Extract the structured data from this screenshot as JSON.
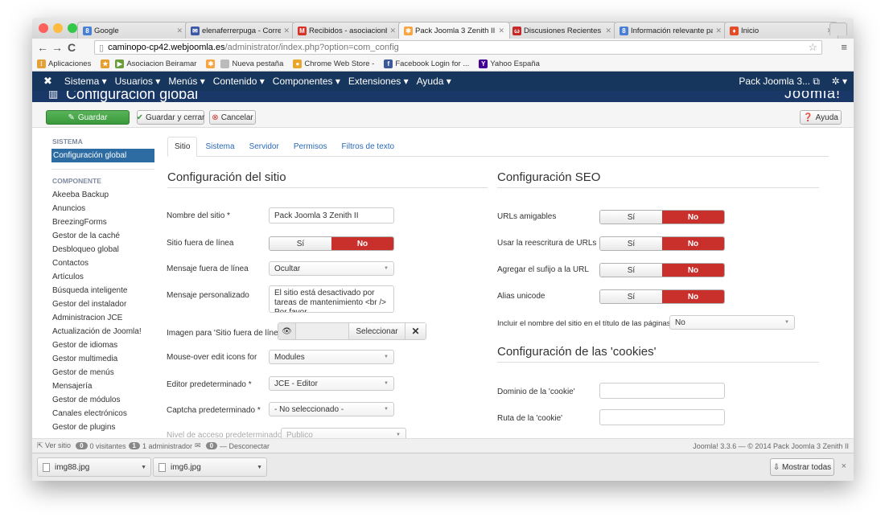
{
  "browser": {
    "tabs": [
      {
        "title": "Google",
        "favicon": "google-icon",
        "color": "#4a7fd6",
        "glyph": "8"
      },
      {
        "title": "elenaferrerpuga - Correo",
        "favicon": "mail-icon",
        "color": "#3b57a8",
        "glyph": "✉"
      },
      {
        "title": "Recibidos - asociacionbe",
        "favicon": "gmail-icon",
        "color": "#d93025",
        "glyph": "M"
      },
      {
        "title": "Pack Joomla 3 Zenith II -",
        "favicon": "joomla-icon",
        "color": "#f9a541",
        "glyph": "✱"
      },
      {
        "title": "Discusiones Recientes (1:",
        "favicon": "discussion-icon",
        "color": "#c62828",
        "glyph": "ω"
      },
      {
        "title": "Información relevante par",
        "favicon": "google-icon",
        "color": "#4a7fd6",
        "glyph": "8"
      },
      {
        "title": "Inicio",
        "favicon": "flame-icon",
        "color": "#e34c26",
        "glyph": "♦"
      }
    ],
    "url_host": "caminopo-cp42.webjoomla.es",
    "url_path": "/administrator/index.php?option=com_config",
    "bookmarks": [
      {
        "label": "Aplicaciones",
        "icon": "apps-icon",
        "color": "#e4a13a",
        "glyph": "⁞"
      },
      {
        "label": "",
        "icon": "bookmark-icon",
        "color": "#e59d2b",
        "glyph": "★"
      },
      {
        "label": "Asociacion Beiramar",
        "icon": "bookmark-icon",
        "color": "#6a9d3a",
        "glyph": "▶"
      },
      {
        "label": "",
        "icon": "joomla-icon",
        "color": "#f9a541",
        "glyph": "✱"
      },
      {
        "label": "Nueva pestaña",
        "icon": "page-icon",
        "color": "#bbbbbb",
        "glyph": ""
      },
      {
        "label": "Chrome Web Store -",
        "icon": "chrome-icon",
        "color": "#e8a72a",
        "glyph": "●"
      },
      {
        "label": "Facebook Login for ...",
        "icon": "facebook-icon",
        "color": "#3b5998",
        "glyph": "f"
      },
      {
        "label": "Yahoo España",
        "icon": "yahoo-icon",
        "color": "#410093",
        "glyph": "Y"
      }
    ]
  },
  "joomla": {
    "menu": [
      "Sistema ▾",
      "Usuarios ▾",
      "Menús ▾",
      "Contenido ▾",
      "Componentes ▾",
      "Extensiones ▾",
      "Ayuda ▾"
    ],
    "site_link": "Pack Joomla 3... ⧉",
    "settings_menu": "✲ ▾",
    "page_title": "Configuración global",
    "logo_text": "Joomla!",
    "buttons": {
      "save": "Guardar",
      "save_close": "Guardar y cerrar",
      "cancel": "Cancelar",
      "help": "Ayuda"
    }
  },
  "sidebar": {
    "system_heading": "SISTEMA",
    "system_items": [
      "Configuración global"
    ],
    "component_heading": "COMPONENTE",
    "component_items": [
      "Akeeba Backup",
      "Anuncios",
      "BreezingForms",
      "Gestor de la caché",
      "Desbloqueo global",
      "Contactos",
      "Artículos",
      "Búsqueda inteligente",
      "Gestor del instalador",
      "Administracion JCE",
      "Actualización de Joomla!",
      "Gestor de idiomas",
      "Gestor multimedia",
      "Gestor de menús",
      "Mensajería",
      "Gestor de módulos",
      "Canales electrónicos",
      "Gestor de plugins"
    ]
  },
  "tabs": [
    "Sitio",
    "Sistema",
    "Servidor",
    "Permisos",
    "Filtros de texto"
  ],
  "site": {
    "heading": "Configuración del sitio",
    "site_name_label": "Nombre del sitio *",
    "site_name_value": "Pack Joomla 3 Zenith II",
    "offline_label": "Sitio fuera de línea",
    "offline_message_label": "Mensaje fuera de línea",
    "offline_message_value": "Ocultar",
    "custom_message_label": "Mensaje personalizado",
    "custom_message_value": "El sitio está desactivado por tareas de mantenimiento <br /> Por favor,",
    "offline_image_label": "Imagen para 'Sitio fuera de línea'",
    "select_button": "Seleccionar",
    "mouseover_label": "Mouse-over edit icons for",
    "mouseover_value": "Modules",
    "editor_label": "Editor predeterminado *",
    "editor_value": "JCE - Editor",
    "captcha_label": "Captcha predeterminado *",
    "captcha_value": "- No seleccionado -",
    "access_label": "Nivel de acceso predeterminado *",
    "access_value": "Publico"
  },
  "seo": {
    "heading": "Configuración SEO",
    "rows": [
      {
        "label": "URLs amigables"
      },
      {
        "label": "Usar la reescritura de URLs"
      },
      {
        "label": "Agregar el sufijo a la URL"
      },
      {
        "label": "Alias unicode"
      }
    ],
    "sitename_in_title_label": "Incluir el nombre del sitio en el título de las páginas",
    "sitename_in_title_value": "No"
  },
  "cookies": {
    "heading": "Configuración de las 'cookies'",
    "domain_label": "Dominio de la 'cookie'",
    "path_label": "Ruta de la 'cookie'"
  },
  "toggle": {
    "yes": "Sí",
    "no": "No"
  },
  "status": {
    "view_site": "⇱ Ver sitio",
    "visitors_count": "0",
    "visitors_label": "0 visitantes",
    "admins_count": "1",
    "admins_label": "1 administrador",
    "messages_count": "0",
    "logout": "— Desconectar",
    "version": "Joomla! 3.3.6 — © 2014 Pack Joomla 3 Zenith II"
  },
  "downloads": {
    "files": [
      "img88.jpg",
      "img6.jpg"
    ],
    "show_all": "⇩ Mostrar todas",
    "close": "×"
  }
}
